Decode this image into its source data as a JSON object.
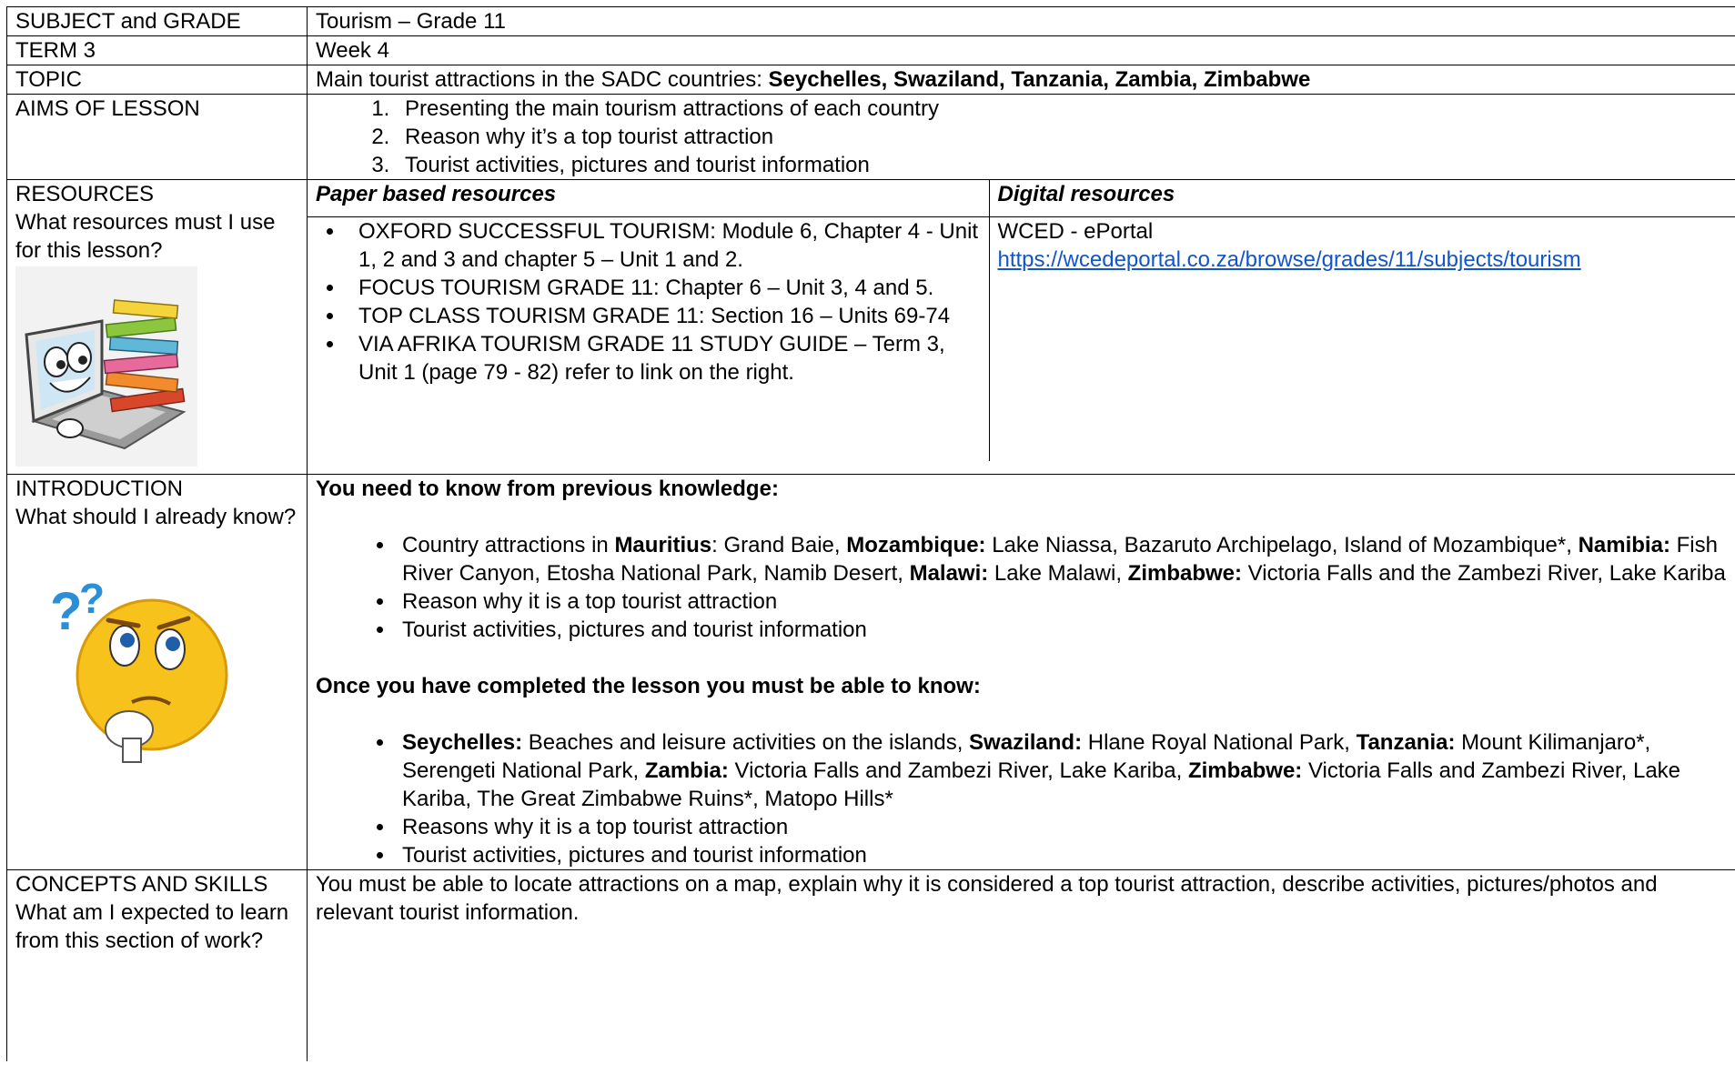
{
  "subject": {
    "label": "SUBJECT and GRADE",
    "value": "Tourism – Grade 11"
  },
  "term": {
    "label": "TERM 3",
    "value": "Week 4"
  },
  "topic": {
    "label": "TOPIC",
    "prefix": "Main tourist attractions in the SADC countries: ",
    "countries": "Seychelles, Swaziland, Tanzania, Zambia, Zimbabwe"
  },
  "aims": {
    "label": "AIMS OF LESSON",
    "items": [
      "Presenting the main tourism attractions of each country",
      "Reason why it’s a top tourist attraction",
      "Tourist activities, pictures and tourist information"
    ]
  },
  "resources": {
    "label": "RESOURCES",
    "question": "What resources must I use for this lesson?",
    "paper_heading": "Paper based resources",
    "digital_heading": "Digital resources",
    "paper_items": [
      "OXFORD SUCCESSFUL TOURISM: Module 6, Chapter 4 - Unit 1, 2 and 3 and chapter 5 – Unit 1 and 2.",
      "FOCUS TOURISM GRADE 11: Chapter 6 – Unit 3, 4 and 5.",
      "TOP CLASS TOURISM GRADE 11: Section 16 – Units 69-74",
      "VIA AFRIKA TOURISM GRADE 11 STUDY GUIDE – Term 3, Unit 1 (page 79 - 82) refer to link on the right."
    ],
    "digital_name": "WCED - ePortal",
    "digital_link": "https://wcedeportal.co.za/browse/grades/11/subjects/tourism"
  },
  "introduction": {
    "label": "INTRODUCTION",
    "question": "What should I already know?",
    "prev_heading": "You need to know from previous knowledge:",
    "prev_1": {
      "t1": "Country attractions in ",
      "b1": "Mauritius",
      "t2": ": Grand Baie, ",
      "b2": "Mozambique:",
      "t3": " Lake Niassa, Bazaruto Archipelago, Island of Mozambique*, ",
      "b3": "Namibia:",
      "t4": " Fish River Canyon, Etosha National Park, Namib Desert, ",
      "b4": "Malawi:",
      "t5": " Lake Malawi, ",
      "b5": "Zimbabwe:",
      "t6": " Victoria Falls and the Zambezi River, Lake Kariba"
    },
    "prev_2": "Reason why it is a top tourist attraction",
    "prev_3": "Tourist activities, pictures and tourist information",
    "after_heading": "Once you have completed the lesson you must be able to know:",
    "after_1": {
      "b1": "Seychelles:",
      "t1": " Beaches and leisure activities on the islands, ",
      "b2": "Swaziland:",
      "t2": " Hlane Royal National Park, ",
      "b3": "Tanzania:",
      "t3": " Mount Kilimanjaro*, Serengeti National Park, ",
      "b4": "Zambia:",
      "t4": " Victoria Falls and Zambezi River, Lake Kariba, ",
      "b5": "Zimbabwe:",
      "t5": " Victoria Falls and Zambezi River, Lake Kariba, The Great Zimbabwe Ruins*, Matopo Hills*"
    },
    "after_2": "Reasons why it is a top tourist attraction",
    "after_3": "Tourist activities, pictures and tourist information"
  },
  "concepts": {
    "label": "CONCEPTS AND SKILLS",
    "question": "What am I expected to learn from this section of work?",
    "text": "You must be able to locate attractions on a map, explain why it is considered a top tourist attraction, describe activities, pictures/photos and relevant tourist information."
  }
}
